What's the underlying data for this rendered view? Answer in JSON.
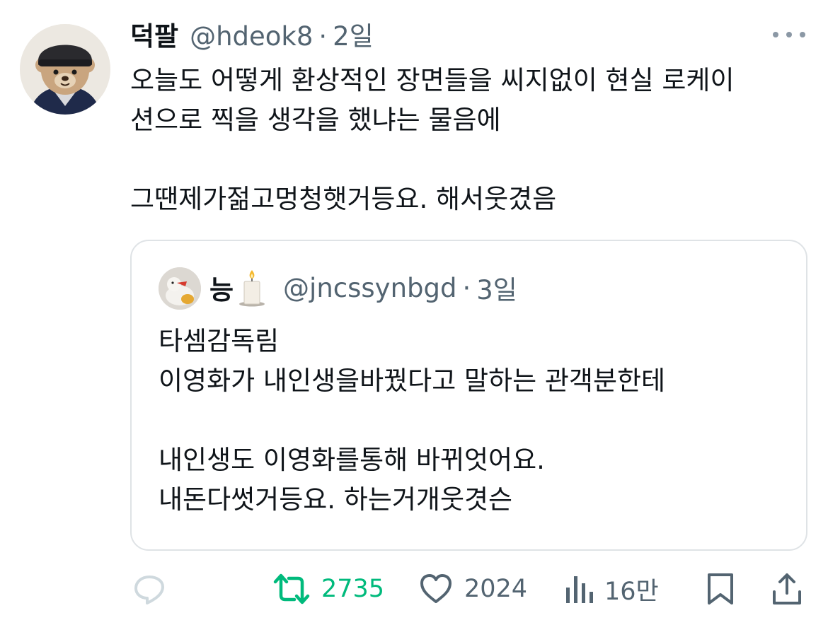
{
  "tweet": {
    "author_name": "덕팔",
    "handle": "@hdeok8",
    "separator": "·",
    "time": "2일",
    "text_lines": [
      "오늘도 어떻게 환상적인 장면들을 씨지없이 현실 로케이",
      "션으로 찍을 생각을 했냐는 물음에",
      "",
      "그땐제가젊고멍청햇거등요. 해서웃겼음"
    ],
    "more_icon": "ellipsis-icon"
  },
  "quoted_tweet": {
    "author_name": "능",
    "emoji": "candle",
    "handle": "@jncssynbgd",
    "separator": "·",
    "time": "3일",
    "text_lines": [
      "타셈감독림",
      "이영화가 내인생을바꿨다고 말하는 관객분한테",
      "",
      "내인생도 이영화를통해 바뀌엇어요.",
      "내돈다썻거등요. 하는거개웃겻슨"
    ]
  },
  "actions": {
    "reply": {
      "icon": "reply-icon",
      "count": ""
    },
    "retweet": {
      "icon": "retweet-icon",
      "count": "2735",
      "color": "#00ba7c"
    },
    "like": {
      "icon": "heart-icon",
      "count": "2024"
    },
    "views": {
      "icon": "views-icon",
      "count": "16만"
    },
    "bookmark": {
      "icon": "bookmark-icon"
    },
    "share": {
      "icon": "share-icon"
    }
  }
}
